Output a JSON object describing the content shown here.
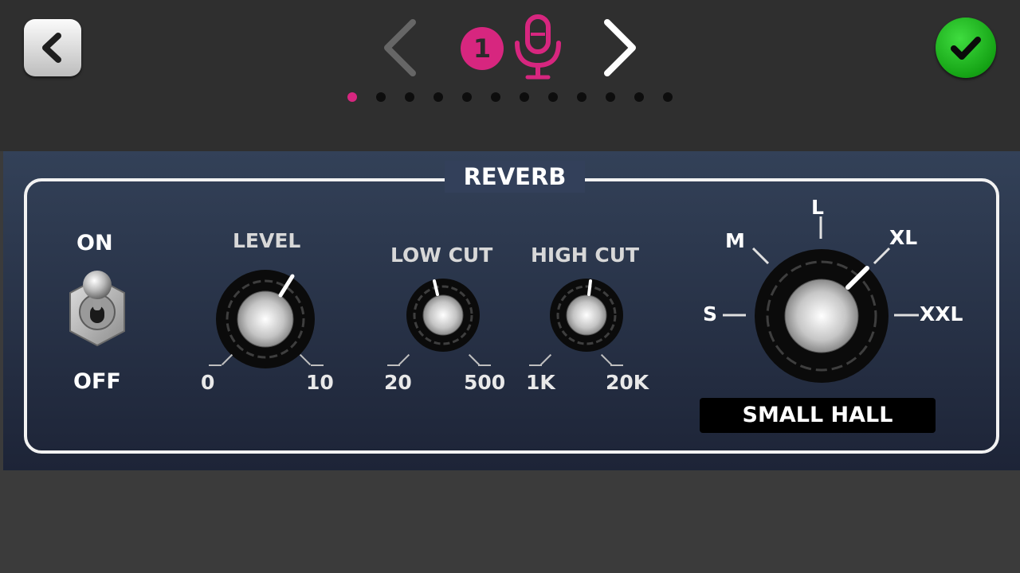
{
  "header": {
    "channel_number": "1",
    "page_dots": {
      "count": 12,
      "active_index": 0
    },
    "icons": {
      "back": "chevron-left-icon",
      "prev": "chevron-left-icon",
      "next": "chevron-right-icon",
      "channel": "microphone-icon",
      "confirm": "checkmark-icon"
    },
    "colors": {
      "accent": "#d7267f",
      "confirm": "#1bb11b"
    }
  },
  "reverb": {
    "title": "REVERB",
    "switch": {
      "on_label": "ON",
      "off_label": "OFF",
      "state": "on"
    },
    "level": {
      "label": "LEVEL",
      "min": "0",
      "max": "10"
    },
    "low_cut": {
      "label": "LOW CUT",
      "min": "20",
      "max": "500"
    },
    "high_cut": {
      "label": "HIGH CUT",
      "min": "1K",
      "max": "20K"
    },
    "size": {
      "options": [
        "S",
        "M",
        "L",
        "XL",
        "XXL"
      ],
      "selected": "XL",
      "display": "SMALL HALL"
    }
  }
}
